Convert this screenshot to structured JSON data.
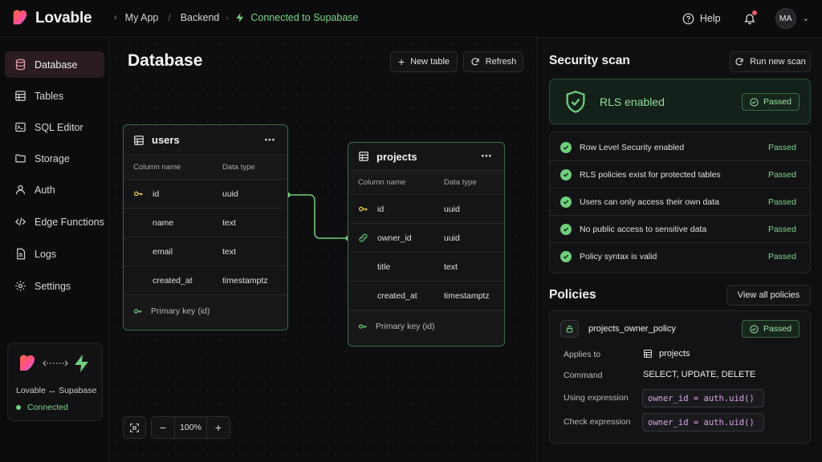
{
  "app": {
    "name": "Lovable"
  },
  "breadcrumb": {
    "project": "My App",
    "section": "Backend",
    "status": "Connected to Supabase"
  },
  "header": {
    "help": "Help",
    "avatar_initials": "MA"
  },
  "sidebar": {
    "items": [
      {
        "label": "Database",
        "icon": "database-icon",
        "active": true
      },
      {
        "label": "Tables",
        "icon": "table-icon"
      },
      {
        "label": "SQL Editor",
        "icon": "terminal-icon"
      },
      {
        "label": "Storage",
        "icon": "folder-icon"
      },
      {
        "label": "Auth",
        "icon": "user-icon"
      },
      {
        "label": "Edge Functions",
        "icon": "code-icon"
      },
      {
        "label": "Logs",
        "icon": "document-icon"
      },
      {
        "label": "Settings",
        "icon": "gear-icon"
      }
    ],
    "promo": {
      "label": "Lovable ↔ Supabase",
      "status": "Connected"
    }
  },
  "main": {
    "title": "Database",
    "new_table": "New table",
    "refresh": "Refresh",
    "zoom": "100%",
    "tables": [
      {
        "name": "users",
        "col_name_header": "Column name",
        "col_type_header": "Data type",
        "rows": [
          {
            "name": "id",
            "type": "uuid",
            "icon": "key-icon"
          },
          {
            "name": "name",
            "type": "text"
          },
          {
            "name": "email",
            "type": "text"
          },
          {
            "name": "created_at",
            "type": "timestamptz"
          }
        ],
        "footer": "Primary key (id)"
      },
      {
        "name": "projects",
        "col_name_header": "Column name",
        "col_type_header": "Data type",
        "rows": [
          {
            "name": "id",
            "type": "uuid",
            "icon": "key-icon"
          },
          {
            "name": "owner_id",
            "type": "uuid",
            "icon": "link-icon"
          },
          {
            "name": "title",
            "type": "text"
          },
          {
            "name": "created_at",
            "type": "timestamptz"
          }
        ],
        "footer": "Primary key (id)"
      }
    ]
  },
  "security": {
    "title": "Security scan",
    "run_button": "Run new scan",
    "rls_label": "RLS enabled",
    "rls_status": "Passed",
    "checks": [
      {
        "label": "Row Level Security enabled",
        "status": "Passed"
      },
      {
        "label": "RLS policies exist for protected tables",
        "status": "Passed"
      },
      {
        "label": "Users can only access their own data",
        "status": "Passed"
      },
      {
        "label": "No public access to sensitive data",
        "status": "Passed"
      },
      {
        "label": "Policy syntax is valid",
        "status": "Passed"
      }
    ]
  },
  "policies": {
    "title": "Policies",
    "view_all": "View all policies",
    "policy": {
      "name": "projects_owner_policy",
      "status": "Passed",
      "applies_to_label": "Applies to",
      "applies_to": "projects",
      "command_label": "Command",
      "command": "SELECT, UPDATE, DELETE",
      "using_label": "Using expression",
      "using": "owner_id = auth.uid()",
      "check_label": "Check expression",
      "check": "owner_id = auth.uid()"
    }
  },
  "colors": {
    "accent_green": "#6fcf7c",
    "active_nav": "#2a1c20",
    "brand_pink": "#ff5c8a"
  }
}
